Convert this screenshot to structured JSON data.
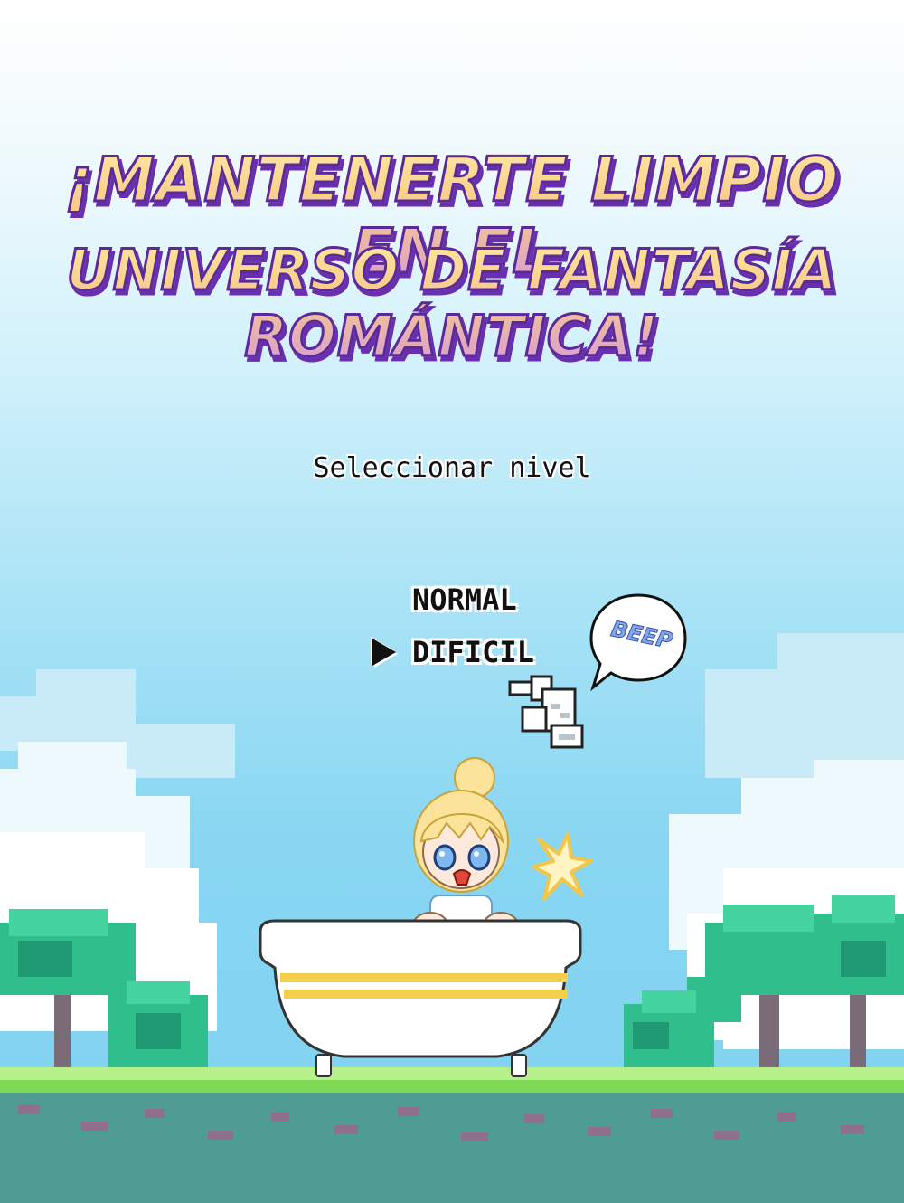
{
  "title": {
    "line1": "¡Mantenerte limpio en el",
    "line2": "universo de fantasía romántica!"
  },
  "menu": {
    "heading": "Seleccionar nivel",
    "options": [
      "NORMAL",
      "DIFICIL"
    ],
    "selected": "DIFICIL"
  },
  "sound_effect": "BEEP",
  "colors": {
    "sky_top": "#ffffff",
    "sky_bottom": "#7fd1f0",
    "title_outline": "#5b2a9a",
    "grass": "#7ed957",
    "dirt": "#4f9c94",
    "tree": "#2fbe8c",
    "tub_stripe": "#f5cf4a"
  },
  "icons": [
    "pointer-arrow-icon",
    "pixel-hand-cursor-icon",
    "speech-bubble-icon",
    "burst-icon"
  ]
}
